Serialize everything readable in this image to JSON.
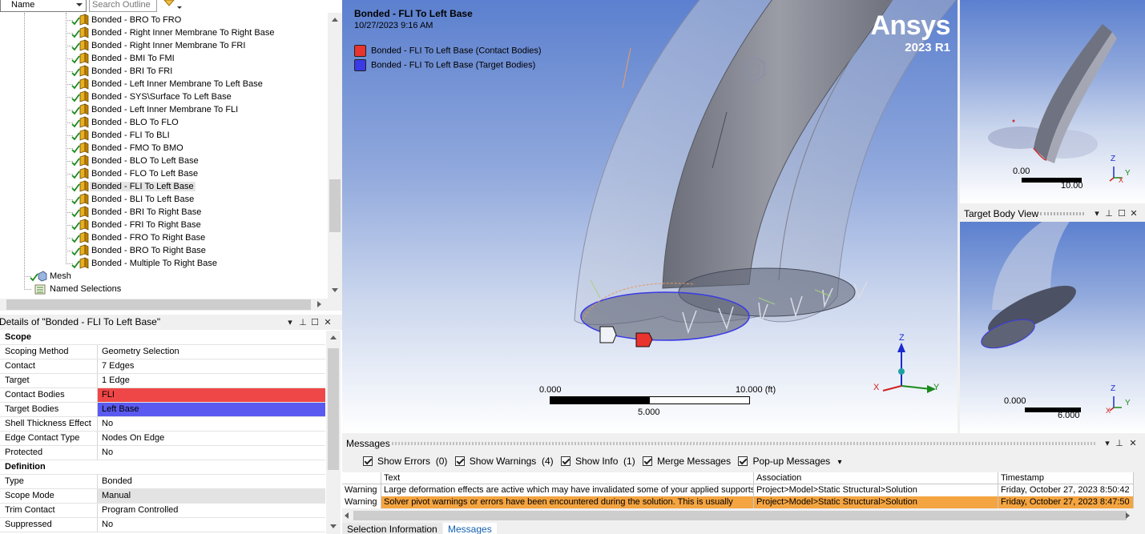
{
  "outline": {
    "sort_select": "Name",
    "search_placeholder": "Search Outline",
    "items": [
      "Bonded - BRO To FRO",
      "Bonded - Right Inner Membrane To Right Base",
      "Bonded - Right Inner Membrane To FRI",
      "Bonded - BMI To FMI",
      "Bonded - BRI To FRI",
      "Bonded - Left Inner Membrane To Left Base",
      "Bonded - SYS\\Surface To Left Base",
      "Bonded - Left Inner Membrane To FLI",
      "Bonded - BLO To FLO",
      "Bonded - FLI To BLI",
      "Bonded - FMO To BMO",
      "Bonded - BLO To Left Base",
      "Bonded - FLO To Left Base",
      "Bonded - FLI To Left Base",
      "Bonded - BLI To Left Base",
      "Bonded - BRI To Right Base",
      "Bonded - FRI To Right Base",
      "Bonded - FRO To Right Base",
      "Bonded - BRO To Right Base",
      "Bonded - Multiple To Right Base"
    ],
    "selected_index": 13,
    "mesh_label": "Mesh",
    "named_selections_label": "Named Selections"
  },
  "details": {
    "title": "Details of \"Bonded - FLI To Left Base\"",
    "rows": [
      {
        "section": "Scope"
      },
      {
        "key": "Scoping Method",
        "value": "Geometry Selection"
      },
      {
        "key": "Contact",
        "value": "7 Edges"
      },
      {
        "key": "Target",
        "value": "1 Edge"
      },
      {
        "key": "Contact Bodies",
        "value": "FLI",
        "hl": "red"
      },
      {
        "key": "Target Bodies",
        "value": "Left Base",
        "hl": "blue"
      },
      {
        "key": "Shell Thickness Effect",
        "value": "No"
      },
      {
        "key": "Edge Contact Type",
        "value": "Nodes On Edge"
      },
      {
        "key": "Protected",
        "value": "No"
      },
      {
        "section": "Definition"
      },
      {
        "key": "Type",
        "value": "Bonded"
      },
      {
        "key": "Scope Mode",
        "value": "Manual",
        "hl": "grey"
      },
      {
        "key": "Trim Contact",
        "value": "Program Controlled"
      },
      {
        "key": "Suppressed",
        "value": "No"
      }
    ]
  },
  "viewport": {
    "title": "Bonded - FLI To Left Base",
    "date": "10/27/2023 9:16 AM",
    "legend": [
      {
        "label": "Bonded - FLI To Left Base (Contact Bodies)",
        "color": "#e8332f"
      },
      {
        "label": "Bonded - FLI To Left Base (Target Bodies)",
        "color": "#3a3ae6"
      }
    ],
    "brand_logo": "Ansys",
    "brand_version": "2023 R1",
    "scale_left": "0.000",
    "scale_right": "10.000 (ft)",
    "scale_mid": "5.000",
    "triad": {
      "z": "Z",
      "x": "X",
      "y": "Y"
    }
  },
  "contact_view": {
    "scale_left": "0.00",
    "scale_right": "10.00",
    "triad": {
      "z": "Z",
      "x": "X",
      "y": "Y"
    }
  },
  "target_view": {
    "title": "Target Body View",
    "scale_left": "0.000",
    "scale_right": "6.000",
    "triad": {
      "z": "Z",
      "x": "X",
      "y": "Y"
    }
  },
  "messages": {
    "title": "Messages",
    "filters": [
      {
        "label": "Show Errors",
        "count": "(0)"
      },
      {
        "label": "Show Warnings",
        "count": "(4)"
      },
      {
        "label": "Show Info",
        "count": "(1)"
      },
      {
        "label": "Merge Messages",
        "count": ""
      },
      {
        "label": "Pop-up Messages",
        "count": ""
      }
    ],
    "columns": [
      "",
      "Text",
      "Association",
      "Timestamp"
    ],
    "rows": [
      {
        "type": "Warning",
        "text": "Large deformation effects are active which may have invalidated some of your applied supports",
        "association": "Project>Model>Static Structural>Solution",
        "timestamp": "Friday, October 27, 2023 8:50:42"
      },
      {
        "type": "Warning",
        "text": "Solver pivot warnings or errors have been encountered during the solution.  This is usually",
        "association": "Project>Model>Static Structural>Solution",
        "timestamp": "Friday, October 27, 2023 8:47:50"
      }
    ],
    "tabs": [
      "Selection Information",
      "Messages"
    ]
  },
  "colors": {
    "contact_red": "#ef4747",
    "target_blue": "#5a5af0",
    "warning_orange": "#f4a440",
    "viewport_top": "#5c80cf"
  }
}
